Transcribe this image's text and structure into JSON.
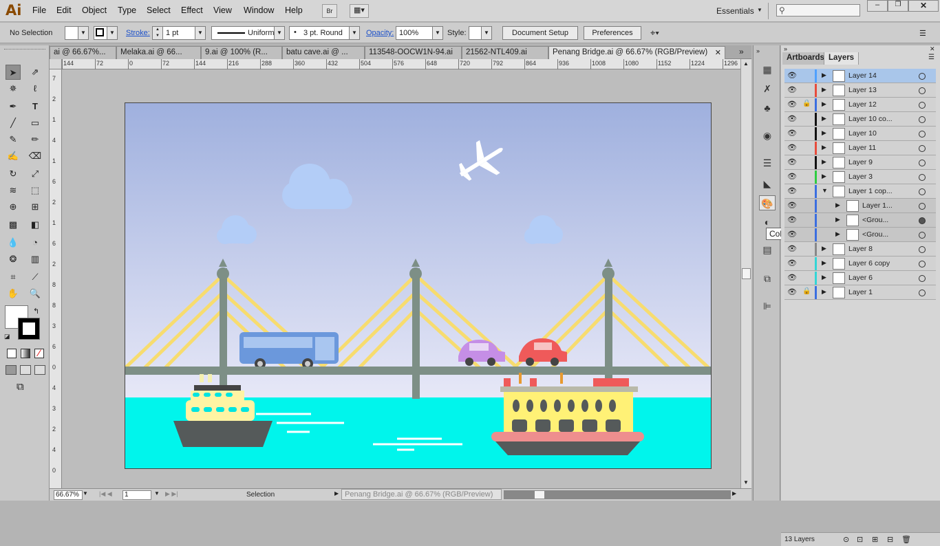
{
  "app": {
    "logo": "Ai",
    "menu": [
      "File",
      "Edit",
      "Object",
      "Type",
      "Select",
      "Effect",
      "View",
      "Window",
      "Help"
    ],
    "br": "Br",
    "workspace": "Essentials",
    "search_placeholder": ""
  },
  "control": {
    "selection": "No Selection",
    "stroke_label": "Stroke:",
    "stroke_value": "1 pt",
    "profile": "Uniform",
    "brush": "3 pt. Round",
    "opacity_label": "Opacity:",
    "opacity_value": "100%",
    "style_label": "Style:",
    "doc_setup": "Document Setup",
    "preferences": "Preferences"
  },
  "tabs": [
    {
      "label": "ai @ 66.67%..."
    },
    {
      "label": "Melaka.ai @ 66..."
    },
    {
      "label": "9.ai @ 100% (R..."
    },
    {
      "label": "batu cave.ai @ ..."
    },
    {
      "label": "113548-OOCW1N-94.ai"
    },
    {
      "label": "21562-NTL409.ai"
    },
    {
      "label": "Penang Bridge.ai @ 66.67% (RGB/Preview)"
    }
  ],
  "ruler_h": [
    "144",
    "72",
    "0",
    "72",
    "144",
    "216",
    "288",
    "360",
    "432",
    "504",
    "576",
    "648",
    "720",
    "792",
    "864",
    "936",
    "1008",
    "1080",
    "1152",
    "1224",
    "1296"
  ],
  "ruler_v": [
    "7",
    "2",
    "1",
    "4",
    "1",
    "6",
    "2",
    "1",
    "6",
    "2",
    "8",
    "8",
    "3",
    "6",
    "0",
    "4",
    "3",
    "2",
    "4",
    "0"
  ],
  "status": {
    "zoom": "66.67%",
    "page": "1",
    "tool": "Selection",
    "drag_title": "Penang Bridge.ai @ 66.67% (RGB/Preview)"
  },
  "tooltip": "Color",
  "panel": {
    "tab_artboards": "Artboards",
    "tab_layers": "Layers",
    "count": "13 Layers"
  },
  "layers": [
    {
      "name": "Layer 14",
      "color": "#4fa0ff",
      "expanded": false,
      "locked": false,
      "selected": true,
      "indent": 0
    },
    {
      "name": "Layer 13",
      "color": "#e74c3c",
      "expanded": false,
      "locked": false,
      "indent": 0
    },
    {
      "name": "Layer 12",
      "color": "#3b6ee0",
      "expanded": false,
      "locked": true,
      "indent": 0
    },
    {
      "name": "Layer 10 co...",
      "color": "#111111",
      "expanded": false,
      "locked": false,
      "indent": 0
    },
    {
      "name": "Layer 10",
      "color": "#111111",
      "expanded": false,
      "locked": false,
      "indent": 0
    },
    {
      "name": "Layer 11",
      "color": "#e74c3c",
      "expanded": false,
      "locked": false,
      "indent": 0
    },
    {
      "name": "Layer 9",
      "color": "#111111",
      "expanded": false,
      "locked": false,
      "indent": 0
    },
    {
      "name": "Layer 3",
      "color": "#2ecc40",
      "expanded": false,
      "locked": false,
      "indent": 0
    },
    {
      "name": "Layer 1 cop...",
      "color": "#3b6ee0",
      "expanded": true,
      "locked": false,
      "indent": 0
    },
    {
      "name": "Layer 1...",
      "color": "#3b6ee0",
      "expanded": false,
      "locked": false,
      "indent": 1
    },
    {
      "name": "<Grou...",
      "color": "#3b6ee0",
      "expanded": false,
      "locked": false,
      "indent": 1,
      "filled": true
    },
    {
      "name": "<Grou...",
      "color": "#3b6ee0",
      "expanded": false,
      "locked": false,
      "indent": 1
    },
    {
      "name": "Layer 8",
      "color": "#888888",
      "expanded": false,
      "locked": false,
      "indent": 0
    },
    {
      "name": "Layer 6 copy",
      "color": "#33d6d6",
      "expanded": false,
      "locked": false,
      "indent": 0
    },
    {
      "name": "Layer 6",
      "color": "#33d6d6",
      "expanded": false,
      "locked": false,
      "indent": 0
    },
    {
      "name": "Layer 1",
      "color": "#3b6ee0",
      "expanded": false,
      "locked": true,
      "indent": 0
    }
  ],
  "colors": {
    "sky_top": "#9fb0de",
    "sky_bottom": "#e4e6f6",
    "water": "#00f5ec",
    "bridge": "#7d8f86",
    "cable": "#f7dc6f",
    "cloud": "#b3cdf7"
  }
}
